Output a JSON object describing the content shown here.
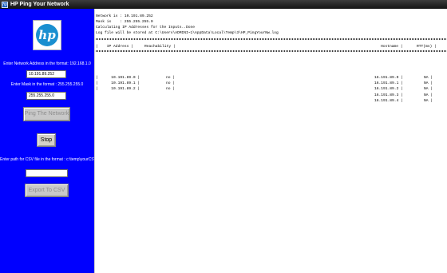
{
  "window": {
    "title": "HP Ping Your Network",
    "icon_glyph": "hp"
  },
  "sidebar": {
    "background": "#0000ff",
    "logo_text": "hp",
    "network_label": "Enter Network Address in the format: 192.168.1.0",
    "network_value": "10.191.89.252",
    "mask_label": "Enter Mask in the format : 255.255.255.0",
    "mask_value": "255.255.255.0",
    "ping_button": "Ping The Network",
    "stop_button": "Stop",
    "csv_label": "Enter path for CSV file in the format : c:\\temp\\yourCSVFile",
    "csv_value": "",
    "export_button": "Export To CSV"
  },
  "output": {
    "lines": [
      "Network is : 10.191.89.252",
      "Mask is    : 255.255.255.0",
      "Calculating IP Addresses for the Inputs..Done",
      "Log file will be stored at C:\\Users\\ADMINI~1\\AppData\\Local\\Temp\\3\\HP_PingYourNw.log"
    ],
    "header": {
      "ip": "|    IP Address |",
      "reach": "Reachability |",
      "host": "Hostname |",
      "rtt": "RTT(ms) |"
    },
    "rows": [
      {
        "ip": "|      10.191.89.0 |",
        "reach": "no |",
        "host": "16.191.89.0 |",
        "rtt": "NA |"
      },
      {
        "ip": "|      10.191.89.1 |",
        "reach": "no |",
        "host": "16.191.89.1 |",
        "rtt": "NA |"
      },
      {
        "ip": "|      10.191.89.2 |",
        "reach": "no |",
        "host": "16.191.89.2 |",
        "rtt": "NA |"
      },
      {
        "ip": "",
        "reach": "",
        "host": "16.191.89.3 |",
        "rtt": "NA |"
      },
      {
        "ip": "",
        "reach": "",
        "host": "16.191.89.4 |",
        "rtt": "NA |"
      }
    ]
  }
}
